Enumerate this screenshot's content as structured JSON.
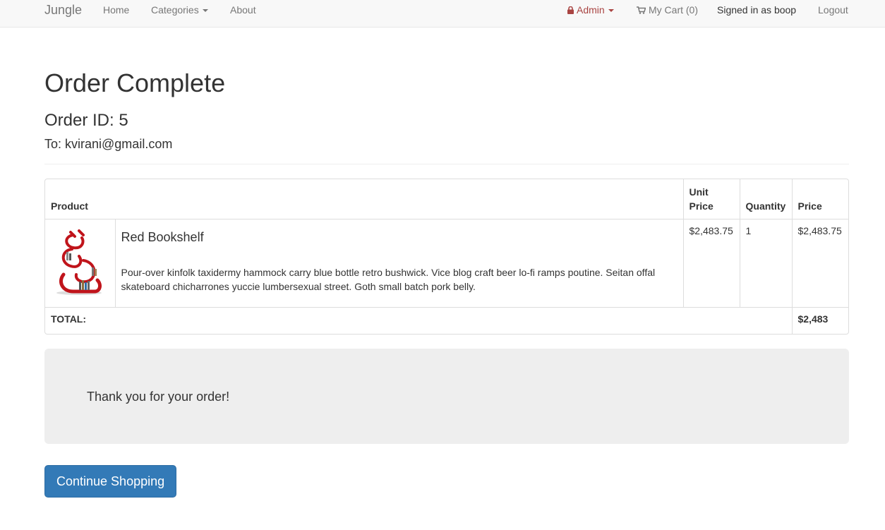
{
  "nav": {
    "brand": "Jungle",
    "home": "Home",
    "categories": "Categories",
    "about": "About",
    "admin": "Admin",
    "cart": "My Cart (0)",
    "signed_in": "Signed in as boop",
    "logout": "Logout"
  },
  "page": {
    "title": "Order Complete",
    "order_id": "Order ID: 5",
    "to": "To: kvirani@gmail.com"
  },
  "table": {
    "headers": {
      "product": "Product",
      "unit_price": "Unit Price",
      "quantity": "Quantity",
      "price": "Price"
    },
    "rows": [
      {
        "name": "Red Bookshelf",
        "description": "Pour-over kinfolk taxidermy hammock carry blue bottle retro bushwick. Vice blog craft beer lo-fi ramps poutine. Seitan offal skateboard chicharrones yuccie lumbersexual street. Goth small batch pork belly.",
        "unit_price": "$2,483.75",
        "quantity": "1",
        "price": "$2,483.75"
      }
    ],
    "total_label": "TOTAL:",
    "total_value": "$2,483"
  },
  "thanks": "Thank you for your order!",
  "continue_button": "Continue Shopping",
  "colors": {
    "primary": "#337ab7",
    "admin": "#a94442",
    "jumbotron": "#eeeeee"
  },
  "icons": {
    "admin": "lock-icon",
    "cart": "shopping-cart-icon",
    "product": "red-bookshelf-image"
  }
}
